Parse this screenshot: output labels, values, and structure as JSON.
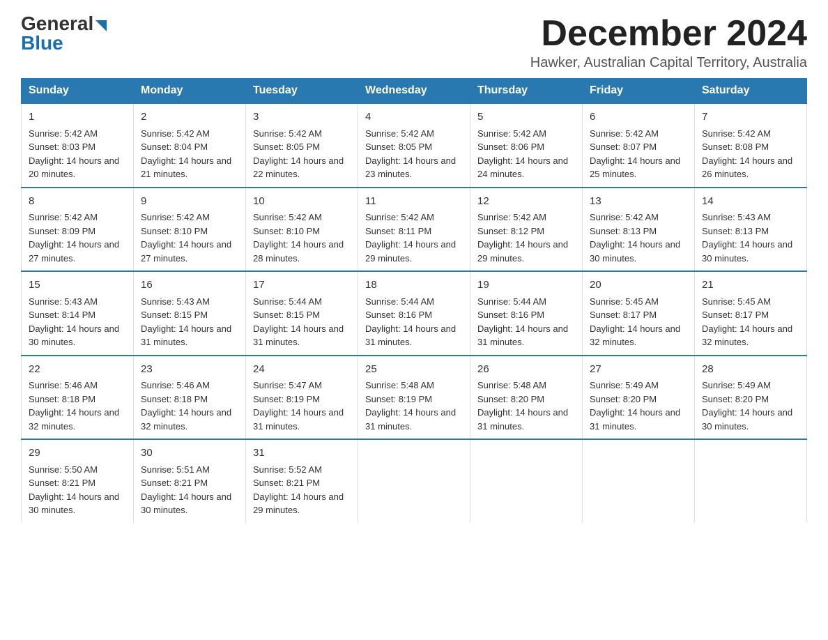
{
  "logo": {
    "part1": "General",
    "part2": "Blue"
  },
  "title": {
    "month": "December 2024",
    "location": "Hawker, Australian Capital Territory, Australia"
  },
  "weekdays": [
    "Sunday",
    "Monday",
    "Tuesday",
    "Wednesday",
    "Thursday",
    "Friday",
    "Saturday"
  ],
  "weeks": [
    [
      {
        "day": "1",
        "sunrise": "5:42 AM",
        "sunset": "8:03 PM",
        "daylight": "14 hours and 20 minutes."
      },
      {
        "day": "2",
        "sunrise": "5:42 AM",
        "sunset": "8:04 PM",
        "daylight": "14 hours and 21 minutes."
      },
      {
        "day": "3",
        "sunrise": "5:42 AM",
        "sunset": "8:05 PM",
        "daylight": "14 hours and 22 minutes."
      },
      {
        "day": "4",
        "sunrise": "5:42 AM",
        "sunset": "8:05 PM",
        "daylight": "14 hours and 23 minutes."
      },
      {
        "day": "5",
        "sunrise": "5:42 AM",
        "sunset": "8:06 PM",
        "daylight": "14 hours and 24 minutes."
      },
      {
        "day": "6",
        "sunrise": "5:42 AM",
        "sunset": "8:07 PM",
        "daylight": "14 hours and 25 minutes."
      },
      {
        "day": "7",
        "sunrise": "5:42 AM",
        "sunset": "8:08 PM",
        "daylight": "14 hours and 26 minutes."
      }
    ],
    [
      {
        "day": "8",
        "sunrise": "5:42 AM",
        "sunset": "8:09 PM",
        "daylight": "14 hours and 27 minutes."
      },
      {
        "day": "9",
        "sunrise": "5:42 AM",
        "sunset": "8:10 PM",
        "daylight": "14 hours and 27 minutes."
      },
      {
        "day": "10",
        "sunrise": "5:42 AM",
        "sunset": "8:10 PM",
        "daylight": "14 hours and 28 minutes."
      },
      {
        "day": "11",
        "sunrise": "5:42 AM",
        "sunset": "8:11 PM",
        "daylight": "14 hours and 29 minutes."
      },
      {
        "day": "12",
        "sunrise": "5:42 AM",
        "sunset": "8:12 PM",
        "daylight": "14 hours and 29 minutes."
      },
      {
        "day": "13",
        "sunrise": "5:42 AM",
        "sunset": "8:13 PM",
        "daylight": "14 hours and 30 minutes."
      },
      {
        "day": "14",
        "sunrise": "5:43 AM",
        "sunset": "8:13 PM",
        "daylight": "14 hours and 30 minutes."
      }
    ],
    [
      {
        "day": "15",
        "sunrise": "5:43 AM",
        "sunset": "8:14 PM",
        "daylight": "14 hours and 30 minutes."
      },
      {
        "day": "16",
        "sunrise": "5:43 AM",
        "sunset": "8:15 PM",
        "daylight": "14 hours and 31 minutes."
      },
      {
        "day": "17",
        "sunrise": "5:44 AM",
        "sunset": "8:15 PM",
        "daylight": "14 hours and 31 minutes."
      },
      {
        "day": "18",
        "sunrise": "5:44 AM",
        "sunset": "8:16 PM",
        "daylight": "14 hours and 31 minutes."
      },
      {
        "day": "19",
        "sunrise": "5:44 AM",
        "sunset": "8:16 PM",
        "daylight": "14 hours and 31 minutes."
      },
      {
        "day": "20",
        "sunrise": "5:45 AM",
        "sunset": "8:17 PM",
        "daylight": "14 hours and 32 minutes."
      },
      {
        "day": "21",
        "sunrise": "5:45 AM",
        "sunset": "8:17 PM",
        "daylight": "14 hours and 32 minutes."
      }
    ],
    [
      {
        "day": "22",
        "sunrise": "5:46 AM",
        "sunset": "8:18 PM",
        "daylight": "14 hours and 32 minutes."
      },
      {
        "day": "23",
        "sunrise": "5:46 AM",
        "sunset": "8:18 PM",
        "daylight": "14 hours and 32 minutes."
      },
      {
        "day": "24",
        "sunrise": "5:47 AM",
        "sunset": "8:19 PM",
        "daylight": "14 hours and 31 minutes."
      },
      {
        "day": "25",
        "sunrise": "5:48 AM",
        "sunset": "8:19 PM",
        "daylight": "14 hours and 31 minutes."
      },
      {
        "day": "26",
        "sunrise": "5:48 AM",
        "sunset": "8:20 PM",
        "daylight": "14 hours and 31 minutes."
      },
      {
        "day": "27",
        "sunrise": "5:49 AM",
        "sunset": "8:20 PM",
        "daylight": "14 hours and 31 minutes."
      },
      {
        "day": "28",
        "sunrise": "5:49 AM",
        "sunset": "8:20 PM",
        "daylight": "14 hours and 30 minutes."
      }
    ],
    [
      {
        "day": "29",
        "sunrise": "5:50 AM",
        "sunset": "8:21 PM",
        "daylight": "14 hours and 30 minutes."
      },
      {
        "day": "30",
        "sunrise": "5:51 AM",
        "sunset": "8:21 PM",
        "daylight": "14 hours and 30 minutes."
      },
      {
        "day": "31",
        "sunrise": "5:52 AM",
        "sunset": "8:21 PM",
        "daylight": "14 hours and 29 minutes."
      },
      null,
      null,
      null,
      null
    ]
  ]
}
